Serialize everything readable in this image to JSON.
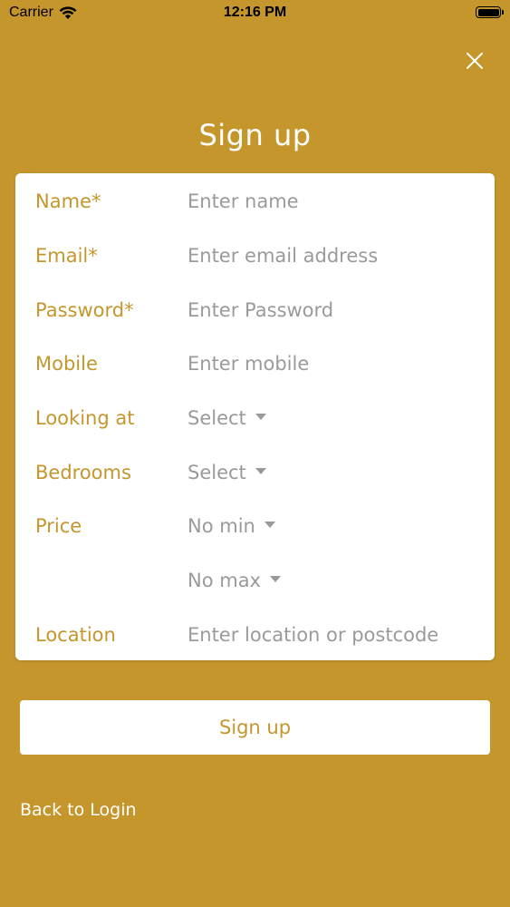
{
  "status_bar": {
    "carrier": "Carrier",
    "time": "12:16 PM",
    "wifi_icon": "wifi-icon",
    "battery_icon": "battery-icon"
  },
  "header": {
    "title": "Sign up",
    "close_icon": "close-icon"
  },
  "form": {
    "name": {
      "label": "Name*",
      "placeholder": "Enter name"
    },
    "email": {
      "label": "Email*",
      "placeholder": "Enter email address"
    },
    "password": {
      "label": "Password*",
      "placeholder": "Enter Password"
    },
    "mobile": {
      "label": "Mobile",
      "placeholder": "Enter mobile"
    },
    "looking_at": {
      "label": "Looking at",
      "value": "Select"
    },
    "bedrooms": {
      "label": "Bedrooms",
      "value": "Select"
    },
    "price": {
      "label": "Price",
      "min_value": "No min",
      "max_value": "No max"
    },
    "location": {
      "label": "Location",
      "placeholder": "Enter location or postcode"
    }
  },
  "actions": {
    "signup_label": "Sign up",
    "back_label": "Back to Login"
  },
  "colors": {
    "brand": "#C4962C",
    "card": "#FFFFFF",
    "placeholder": "#9A9A9A"
  }
}
